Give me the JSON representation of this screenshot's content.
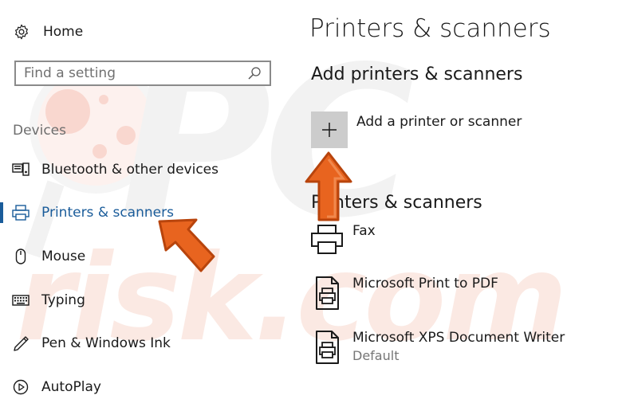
{
  "watermark": {
    "brand": "PC",
    "site": "risk.com"
  },
  "sidebar": {
    "home_label": "Home",
    "search_placeholder": "Find a setting",
    "section_label": "Devices",
    "items": [
      {
        "label": "Bluetooth & other devices",
        "icon": "bluetooth-devices-icon",
        "active": false
      },
      {
        "label": "Printers & scanners",
        "icon": "printer-icon",
        "active": true
      },
      {
        "label": "Mouse",
        "icon": "mouse-icon",
        "active": false
      },
      {
        "label": "Typing",
        "icon": "keyboard-icon",
        "active": false
      },
      {
        "label": "Pen & Windows Ink",
        "icon": "pen-icon",
        "active": false
      },
      {
        "label": "AutoPlay",
        "icon": "autoplay-icon",
        "active": false
      }
    ]
  },
  "main": {
    "title": "Printers & scanners",
    "add_section_title": "Add printers & scanners",
    "add_button_label": "Add a printer or scanner",
    "list_section_title": "Printers & scanners",
    "devices": [
      {
        "name": "Fax",
        "status": "",
        "icon": "fax-printer-icon"
      },
      {
        "name": "Microsoft Print to PDF",
        "status": "",
        "icon": "document-printer-icon"
      },
      {
        "name": "Microsoft XPS Document Writer",
        "status": "Default",
        "icon": "document-printer-icon"
      }
    ]
  },
  "colors": {
    "accent": "#1a5c9a",
    "annotation_arrow": "#e8641f",
    "button_bg": "#cccccc"
  }
}
